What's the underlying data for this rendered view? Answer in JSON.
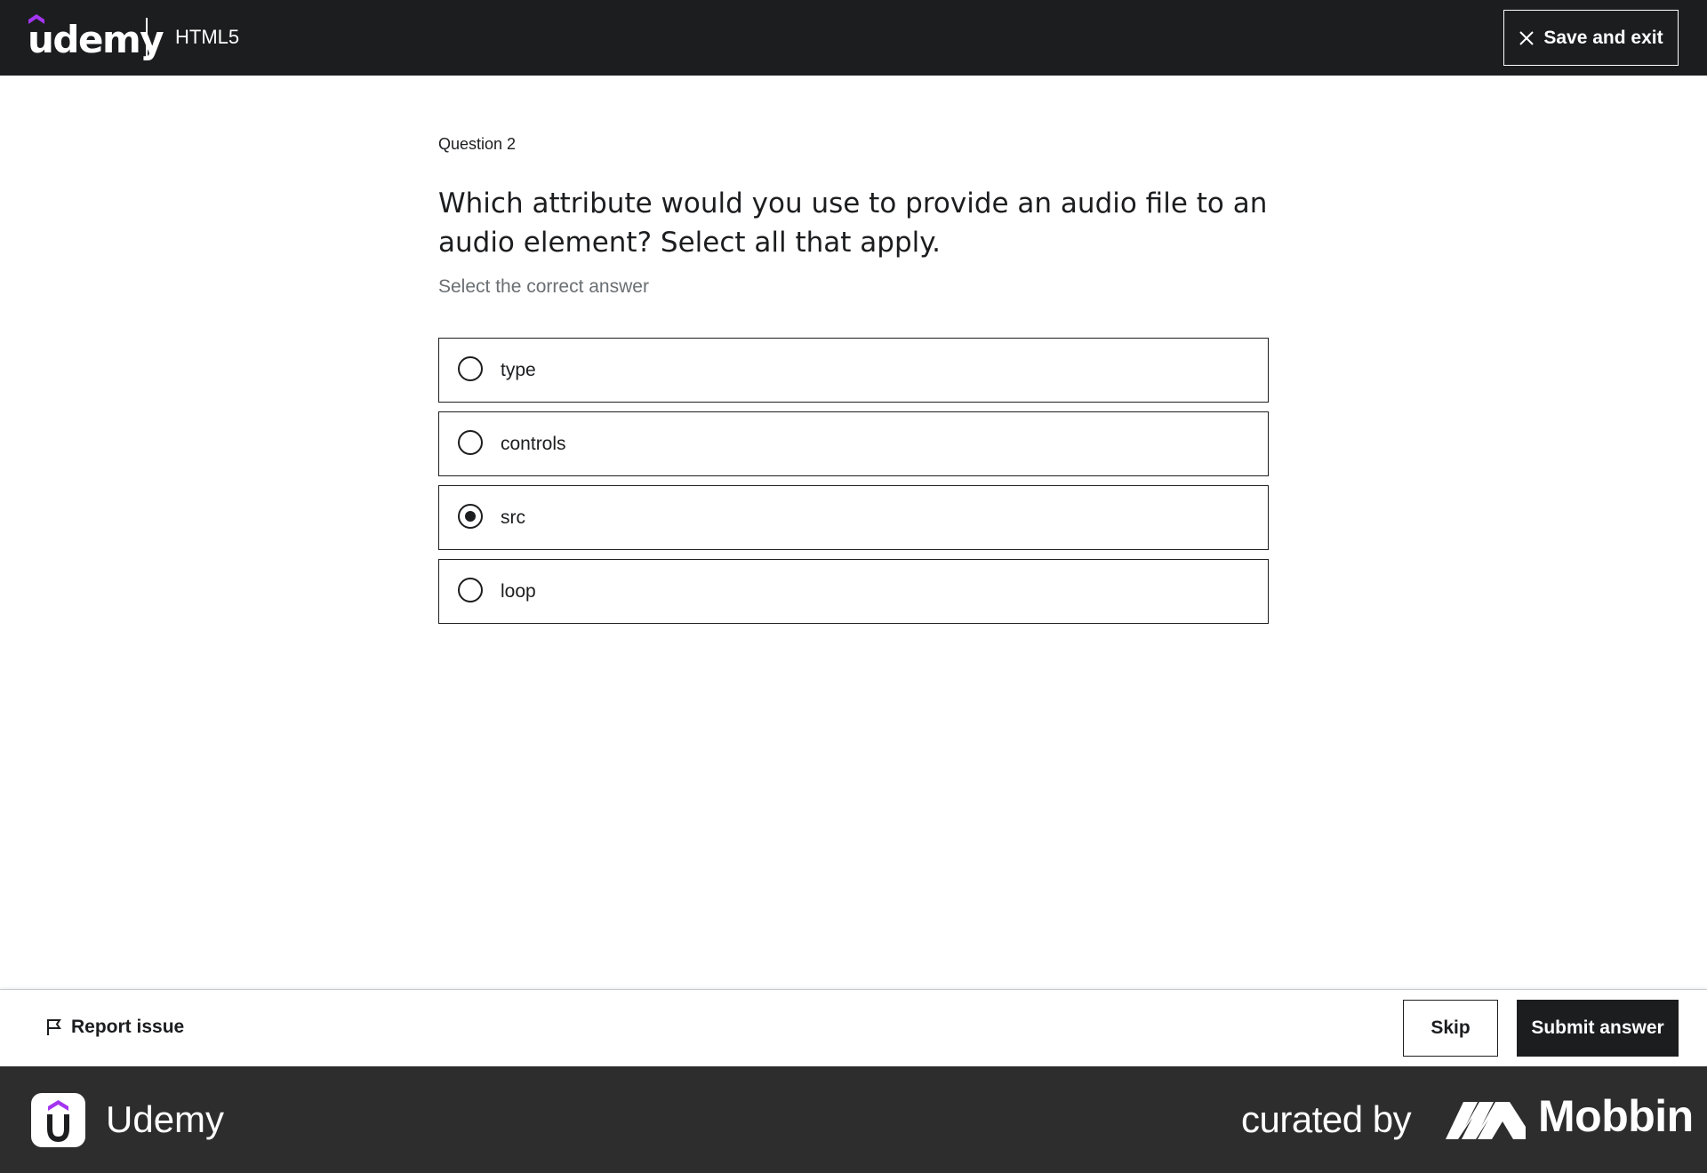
{
  "header": {
    "logo_text": "udemy",
    "course_title": "HTML5",
    "save_exit_label": "Save and exit"
  },
  "question": {
    "number_label": "Question 2",
    "text": "Which attribute would you use to provide an audio file to an audio element? Select all that apply.",
    "hint": "Select the correct answer",
    "options": [
      {
        "label": "type",
        "selected": false
      },
      {
        "label": "controls",
        "selected": false
      },
      {
        "label": "src",
        "selected": true
      },
      {
        "label": "loop",
        "selected": false
      }
    ]
  },
  "footer": {
    "report_label": "Report issue",
    "skip_label": "Skip",
    "submit_label": "Submit answer"
  },
  "banner": {
    "app_name": "Udemy",
    "curated_label": "curated by",
    "brand_name": "Mobbin"
  },
  "icons": {
    "close": "close-icon",
    "flag": "flag-icon",
    "radio_checked": "radio-checked-icon",
    "radio_unchecked": "radio-unchecked-icon"
  },
  "colors": {
    "header_bg": "#1c1d1f",
    "banner_bg": "#2d2d2e",
    "brand_purple": "#a435f0",
    "text_primary": "#1c1d1f",
    "text_muted": "#6a6f73"
  }
}
